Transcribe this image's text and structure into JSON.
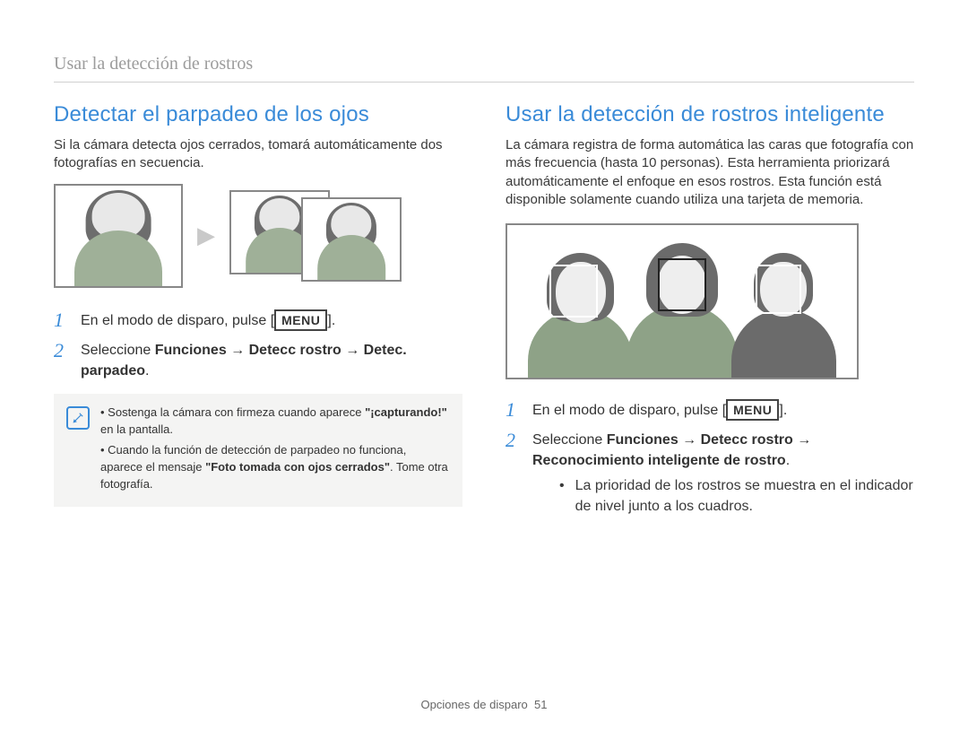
{
  "running_head": "Usar la detección de rostros",
  "left": {
    "heading": "Detectar el parpadeo de los ojos",
    "intro": "Si la cámara detecta ojos cerrados, tomará automáticamente dos fotografías en secuencia.",
    "steps": [
      {
        "num": "1",
        "pre": "En el modo de disparo, pulse [",
        "menu": "MENU",
        "post": "]."
      },
      {
        "num": "2",
        "text_parts": [
          {
            "t": "Seleccione ",
            "b": false
          },
          {
            "t": "Funciones",
            "b": true
          },
          {
            "t": " → ",
            "b": false
          },
          {
            "t": "Detecc rostro",
            "b": true
          },
          {
            "t": " → ",
            "b": false
          },
          {
            "t": "Detec. parpadeo",
            "b": true
          },
          {
            "t": ".",
            "b": false
          }
        ]
      }
    ],
    "note": {
      "items": [
        [
          {
            "t": "Sostenga la cámara con firmeza cuando aparece ",
            "b": false
          },
          {
            "t": "\"¡capturando!\"",
            "b": true
          },
          {
            "t": " en la pantalla.",
            "b": false
          }
        ],
        [
          {
            "t": "Cuando la función de detección de parpadeo no funciona, aparece el mensaje ",
            "b": false
          },
          {
            "t": "\"Foto tomada con ojos cerrados\"",
            "b": true
          },
          {
            "t": ". Tome otra fotografía.",
            "b": false
          }
        ]
      ]
    }
  },
  "right": {
    "heading": "Usar la detección de rostros inteligente",
    "intro": "La cámara registra de forma automática las caras que fotografía con más frecuencia (hasta 10 personas). Esta herramienta priorizará automáticamente el enfoque en esos rostros. Esta función está disponible solamente cuando utiliza una tarjeta de memoria.",
    "steps": [
      {
        "num": "1",
        "pre": "En el modo de disparo, pulse [",
        "menu": "MENU",
        "post": "]."
      },
      {
        "num": "2",
        "text_parts": [
          {
            "t": "Seleccione ",
            "b": false
          },
          {
            "t": "Funciones",
            "b": true
          },
          {
            "t": " → ",
            "b": false
          },
          {
            "t": "Detecc rostro",
            "b": true
          },
          {
            "t": " → ",
            "b": false
          },
          {
            "t": "Reconocimiento inteligente de rostro",
            "b": true
          },
          {
            "t": ".",
            "b": false
          }
        ],
        "bullets": [
          "La prioridad de los rostros se muestra en el indicador de nivel junto a los cuadros."
        ]
      }
    ]
  },
  "footer": {
    "section": "Opciones de disparo",
    "page": "51"
  }
}
